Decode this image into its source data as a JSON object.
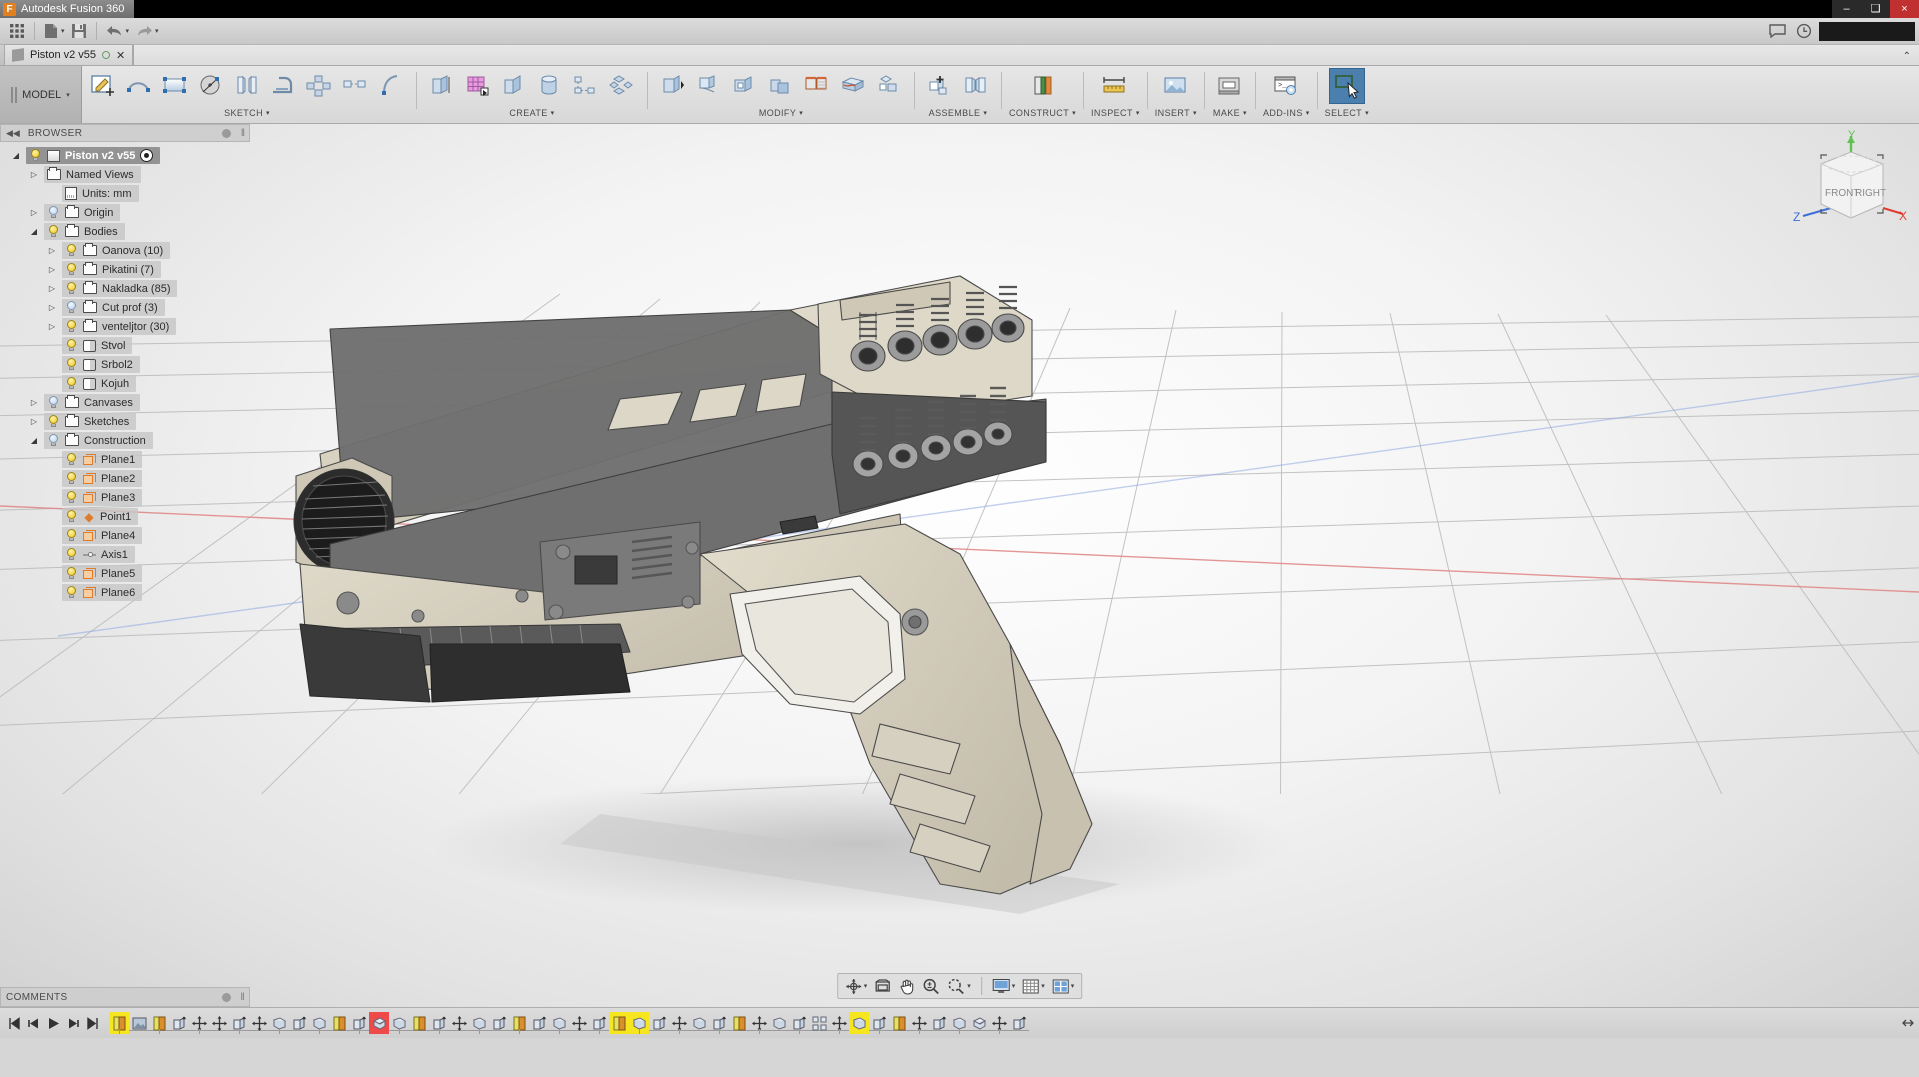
{
  "titlebar": {
    "app_name": "Autodesk Fusion 360",
    "logo_letter": "F",
    "minimize": "–",
    "maximize": "❑",
    "close": "×"
  },
  "appbar": {
    "grid_menu": "app-grid",
    "new_label": "New",
    "save_label": "Save",
    "undo_label": "Undo",
    "redo_label": "Redo",
    "comment_label": "Comments",
    "history_label": "Recent",
    "caret": "▾"
  },
  "doctab": {
    "title": "Piston v2 v55",
    "close": "✕",
    "chevron": "⌃"
  },
  "ribbon": {
    "workspace": "MODEL",
    "workspace_caret": "▾",
    "groups": [
      {
        "label": "SKETCH",
        "caret": "▾",
        "buttons": [
          "create-sketch",
          "spline",
          "rectangle",
          "circle",
          "mirror",
          "fillet",
          "rectangular-pattern",
          "project",
          "arc"
        ]
      },
      {
        "label": "CREATE",
        "caret": "▾",
        "buttons": [
          "extrude",
          "new-component",
          "revolve",
          "cylinder",
          "pattern",
          "box"
        ]
      },
      {
        "label": "MODIFY",
        "caret": "▾",
        "buttons": [
          "press-pull",
          "fillet-3d",
          "shell",
          "combine",
          "split-face",
          "draft",
          "scale"
        ]
      },
      {
        "label": "ASSEMBLE",
        "caret": "▾",
        "buttons": [
          "new-component-assembly",
          "joint"
        ]
      },
      {
        "label": "CONSTRUCT",
        "caret": "▾",
        "buttons": [
          "offset-plane"
        ]
      },
      {
        "label": "INSPECT",
        "caret": "▾",
        "buttons": [
          "measure"
        ]
      },
      {
        "label": "INSERT",
        "caret": "▾",
        "buttons": [
          "insert-mcmaster"
        ]
      },
      {
        "label": "MAKE",
        "caret": "▾",
        "buttons": [
          "3d-print"
        ]
      },
      {
        "label": "ADD-INS",
        "caret": "▾",
        "buttons": [
          "scripts-and-addins"
        ]
      },
      {
        "label": "SELECT",
        "caret": "▾",
        "buttons": [
          "select-tool"
        ]
      }
    ]
  },
  "browser": {
    "header": "BROWSER",
    "collapse": "◀◀",
    "grip": "‖",
    "tree": [
      {
        "label": "Piston v2 v55",
        "indent": 0,
        "tri": "open",
        "bulb": "on",
        "icon": "root-cube",
        "extra": "target",
        "kind": "root"
      },
      {
        "label": "Named Views",
        "indent": 1,
        "tri": "closed",
        "bulb": "none",
        "icon": "folder"
      },
      {
        "label": "Units: mm",
        "indent": 2,
        "tri": "none",
        "bulb": "none",
        "icon": "document"
      },
      {
        "label": "Origin",
        "indent": 1,
        "tri": "closed",
        "bulb": "off",
        "icon": "folder"
      },
      {
        "label": "Bodies",
        "indent": 1,
        "tri": "open",
        "bulb": "on",
        "icon": "folder"
      },
      {
        "label": "Oanova (10)",
        "indent": 2,
        "tri": "closed",
        "bulb": "on",
        "icon": "folder"
      },
      {
        "label": "Pikatini (7)",
        "indent": 2,
        "tri": "closed",
        "bulb": "on",
        "icon": "folder"
      },
      {
        "label": "Nakladka (85)",
        "indent": 2,
        "tri": "closed",
        "bulb": "on",
        "icon": "folder"
      },
      {
        "label": "Cut prof (3)",
        "indent": 2,
        "tri": "closed",
        "bulb": "off",
        "icon": "folder"
      },
      {
        "label": "venteljtor (30)",
        "indent": 2,
        "tri": "closed",
        "bulb": "on",
        "icon": "folder"
      },
      {
        "label": "Stvol",
        "indent": 2,
        "tri": "none",
        "bulb": "on",
        "icon": "body"
      },
      {
        "label": "Srbol2",
        "indent": 2,
        "tri": "none",
        "bulb": "on",
        "icon": "body"
      },
      {
        "label": "Kojuh",
        "indent": 2,
        "tri": "none",
        "bulb": "on",
        "icon": "body"
      },
      {
        "label": "Canvases",
        "indent": 1,
        "tri": "closed",
        "bulb": "off",
        "icon": "folder"
      },
      {
        "label": "Sketches",
        "indent": 1,
        "tri": "closed",
        "bulb": "on",
        "icon": "folder"
      },
      {
        "label": "Construction",
        "indent": 1,
        "tri": "open",
        "bulb": "off",
        "icon": "folder"
      },
      {
        "label": "Plane1",
        "indent": 2,
        "tri": "none",
        "bulb": "on",
        "icon": "plane"
      },
      {
        "label": "Plane2",
        "indent": 2,
        "tri": "none",
        "bulb": "on",
        "icon": "plane"
      },
      {
        "label": "Plane3",
        "indent": 2,
        "tri": "none",
        "bulb": "on",
        "icon": "plane"
      },
      {
        "label": "Point1",
        "indent": 2,
        "tri": "none",
        "bulb": "on",
        "icon": "point"
      },
      {
        "label": "Plane4",
        "indent": 2,
        "tri": "none",
        "bulb": "on",
        "icon": "plane"
      },
      {
        "label": "Axis1",
        "indent": 2,
        "tri": "none",
        "bulb": "on",
        "icon": "axis"
      },
      {
        "label": "Plane5",
        "indent": 2,
        "tri": "none",
        "bulb": "on",
        "icon": "plane"
      },
      {
        "label": "Plane6",
        "indent": 2,
        "tri": "none",
        "bulb": "on",
        "icon": "plane"
      }
    ]
  },
  "viewcube": {
    "front_face": "FRONT",
    "right_face": "RIGHT",
    "axis_x": "X",
    "axis_y": "Y",
    "axis_z": "Z",
    "color_x": "#e03c31",
    "color_y": "#5ec24f",
    "color_z": "#3a6fd8"
  },
  "navbar": {
    "buttons": [
      {
        "name": "orbit-icon",
        "caret": "▾"
      },
      {
        "name": "look-at-icon",
        "caret": ""
      },
      {
        "name": "pan-hand-icon",
        "caret": ""
      },
      {
        "name": "zoom-magnifier-icon",
        "caret": ""
      },
      {
        "name": "fit-zoom-icon",
        "caret": "▾"
      },
      {
        "name": "display-settings-icon",
        "caret": "▾"
      },
      {
        "name": "grid-snaps-icon",
        "caret": "▾"
      },
      {
        "name": "viewports-icon",
        "caret": "▾"
      }
    ]
  },
  "comments": {
    "label": "COMMENTS",
    "grip": "‖"
  },
  "timeline": {
    "nav": [
      "go-to-beginning",
      "step-back",
      "play",
      "step-forward",
      "go-to-end"
    ],
    "features": [
      {
        "name": "sketch-feature",
        "state": "highlight-yellow"
      },
      {
        "name": "canvas-feature",
        "state": "normal"
      },
      {
        "name": "sketch-feature",
        "state": "normal"
      },
      {
        "name": "extrude-feature",
        "state": "normal"
      },
      {
        "name": "move-feature",
        "state": "normal"
      },
      {
        "name": "move-feature",
        "state": "normal"
      },
      {
        "name": "extrude-feature",
        "state": "normal"
      },
      {
        "name": "move-feature",
        "state": "normal"
      },
      {
        "name": "plane-feature",
        "state": "normal"
      },
      {
        "name": "extrude-feature",
        "state": "normal"
      },
      {
        "name": "plane-feature",
        "state": "normal"
      },
      {
        "name": "sketch-feature",
        "state": "normal"
      },
      {
        "name": "extrude-feature",
        "state": "normal"
      },
      {
        "name": "fillet-feature",
        "state": "highlight-red"
      },
      {
        "name": "plane-feature",
        "state": "normal"
      },
      {
        "name": "sketch-feature",
        "state": "normal"
      },
      {
        "name": "extrude-feature",
        "state": "normal"
      },
      {
        "name": "move-feature",
        "state": "normal"
      },
      {
        "name": "plane-feature",
        "state": "normal"
      },
      {
        "name": "extrude-feature",
        "state": "normal"
      },
      {
        "name": "sketch-feature",
        "state": "normal"
      },
      {
        "name": "extrude-feature",
        "state": "normal"
      },
      {
        "name": "plane-feature",
        "state": "normal"
      },
      {
        "name": "move-feature",
        "state": "normal"
      },
      {
        "name": "extrude-feature",
        "state": "normal"
      },
      {
        "name": "sketch-feature",
        "state": "highlight-yellow"
      },
      {
        "name": "plane-feature",
        "state": "highlight-yellow"
      },
      {
        "name": "extrude-feature",
        "state": "normal"
      },
      {
        "name": "move-feature",
        "state": "normal"
      },
      {
        "name": "plane-feature",
        "state": "normal"
      },
      {
        "name": "extrude-feature",
        "state": "normal"
      },
      {
        "name": "sketch-feature",
        "state": "normal"
      },
      {
        "name": "move-feature",
        "state": "normal"
      },
      {
        "name": "plane-feature",
        "state": "normal"
      },
      {
        "name": "extrude-feature",
        "state": "normal"
      },
      {
        "name": "pattern-feature",
        "state": "normal"
      },
      {
        "name": "move-feature",
        "state": "normal"
      },
      {
        "name": "plane-feature",
        "state": "highlight-yellow"
      },
      {
        "name": "extrude-feature",
        "state": "normal"
      },
      {
        "name": "sketch-feature",
        "state": "normal"
      },
      {
        "name": "move-feature",
        "state": "normal"
      },
      {
        "name": "extrude-feature",
        "state": "normal"
      },
      {
        "name": "plane-feature",
        "state": "normal"
      },
      {
        "name": "fillet-feature",
        "state": "normal"
      },
      {
        "name": "move-feature",
        "state": "normal"
      },
      {
        "name": "extrude-feature",
        "state": "normal"
      }
    ]
  },
  "model": {
    "name": "pistol-3d-model",
    "body_light": "#ded8c8",
    "body_mid": "#c9c2b0",
    "body_dark": "#6f6f6f",
    "body_darker": "#4f4f4f",
    "shadow": "#c2c2c2"
  }
}
